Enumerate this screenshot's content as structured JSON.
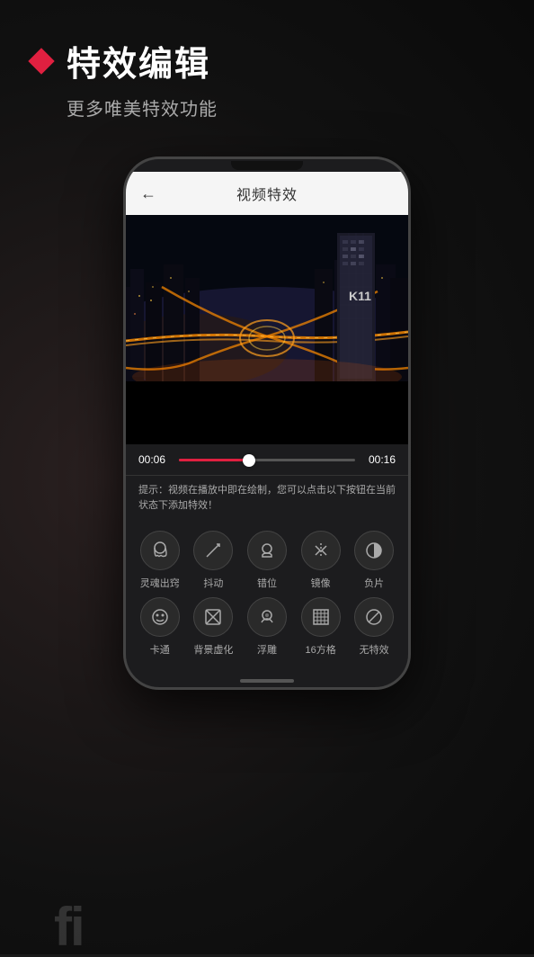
{
  "page": {
    "background_color": "#1a1a1a"
  },
  "header": {
    "diamond_icon": "diamond",
    "main_title": "特效编辑",
    "sub_title": "更多唯美特效功能"
  },
  "phone": {
    "app_header": {
      "back_label": "←",
      "title": "视频特效"
    },
    "timeline": {
      "start_time": "00:06",
      "end_time": "00:16",
      "progress_percent": 40
    },
    "hint": {
      "text": "提示：视频在播放中即在绘制，您可以点击以下按钮在当前状态下添加特效！"
    },
    "effects_row1": [
      {
        "id": "ghost",
        "icon": "👻",
        "label": "灵魂出窍"
      },
      {
        "id": "shake",
        "icon": "↗",
        "label": "抖动"
      },
      {
        "id": "offset",
        "icon": "👤",
        "label": "错位"
      },
      {
        "id": "mirror",
        "icon": "⬓",
        "label": "镜像"
      },
      {
        "id": "negative",
        "icon": "◑",
        "label": "负片"
      }
    ],
    "effects_row2": [
      {
        "id": "cartoon",
        "icon": "😺",
        "label": "卡通"
      },
      {
        "id": "blur_bg",
        "icon": "⊘",
        "label": "背景虚化"
      },
      {
        "id": "emboss",
        "icon": "👤",
        "label": "浮雕"
      },
      {
        "id": "grid16",
        "icon": "⊞",
        "label": "16方格"
      },
      {
        "id": "none",
        "icon": "⊘",
        "label": "无特效"
      }
    ]
  },
  "bottom": {
    "fi_text": "fi"
  }
}
